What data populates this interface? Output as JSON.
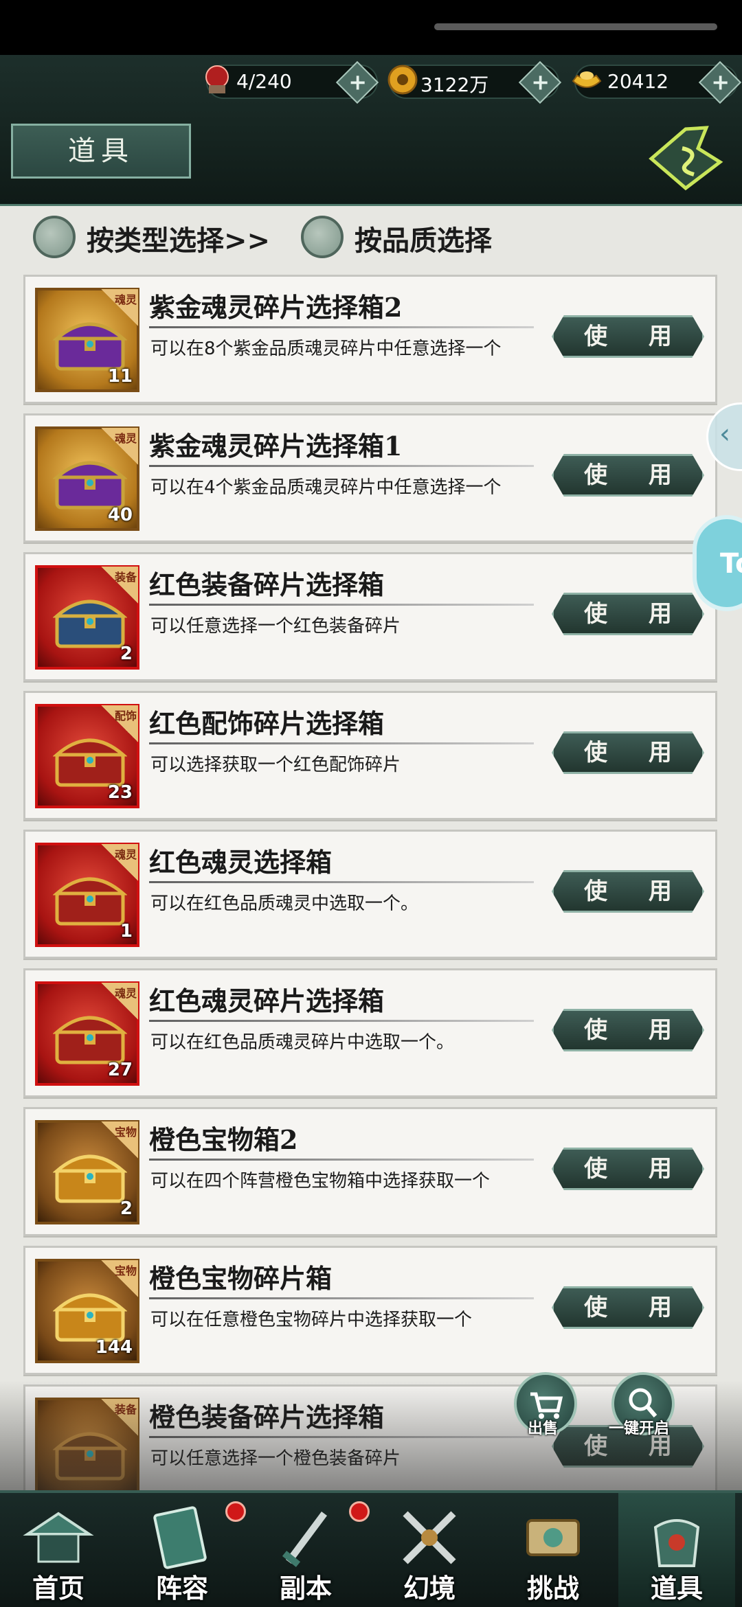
{
  "header": {
    "resources": [
      {
        "name": "stamina",
        "value": "4/240",
        "icon": "ball-icon",
        "color": "#b01f1f"
      },
      {
        "name": "coins",
        "value": "3122万",
        "icon": "coin-icon",
        "color": "#e0a020"
      },
      {
        "name": "ingots",
        "value": "20412",
        "icon": "ingot-icon",
        "color": "#e8b42a"
      }
    ],
    "page_title": "道具"
  },
  "filters": {
    "by_type": "按类型选择>>",
    "by_quality": "按品质选择"
  },
  "items": [
    {
      "name": "紫金魂灵碎片选择箱2",
      "desc": "可以在8个紫金品质魂灵碎片中任意选择一个",
      "count": "11",
      "tag": "魂灵",
      "frame": "gold",
      "chest": "purple"
    },
    {
      "name": "紫金魂灵碎片选择箱1",
      "desc": "可以在4个紫金品质魂灵碎片中任意选择一个",
      "count": "40",
      "tag": "魂灵",
      "frame": "gold",
      "chest": "purple"
    },
    {
      "name": "红色装备碎片选择箱",
      "desc": "可以任意选择一个红色装备碎片",
      "count": "2",
      "tag": "装备",
      "frame": "red",
      "chest": "blue-gold"
    },
    {
      "name": "红色配饰碎片选择箱",
      "desc": "可以选择获取一个红色配饰碎片",
      "count": "23",
      "tag": "配饰",
      "frame": "red",
      "chest": "red-gold"
    },
    {
      "name": "红色魂灵选择箱",
      "desc": "可以在红色品质魂灵中选取一个。",
      "count": "1",
      "tag": "魂灵",
      "frame": "red",
      "chest": "red-gold"
    },
    {
      "name": "红色魂灵碎片选择箱",
      "desc": "可以在红色品质魂灵碎片中选取一个。",
      "count": "27",
      "tag": "魂灵",
      "frame": "red",
      "chest": "red-gold"
    },
    {
      "name": "橙色宝物箱2",
      "desc": "可以在四个阵营橙色宝物箱中选择获取一个",
      "count": "2",
      "tag": "宝物",
      "frame": "bronze",
      "chest": "gold"
    },
    {
      "name": "橙色宝物碎片箱",
      "desc": "可以在任意橙色宝物碎片中选择获取一个",
      "count": "144",
      "tag": "宝物",
      "frame": "bronze",
      "chest": "gold"
    },
    {
      "name": "橙色装备碎片选择箱",
      "desc": "可以任意选择一个橙色装备碎片",
      "count": "",
      "tag": "装备",
      "frame": "bronze",
      "chest": "bronze"
    }
  ],
  "use_label": "使 用",
  "float_buttons": {
    "sell": "出售",
    "one_click_open": "一键开启"
  },
  "side_bubble": "To",
  "bottom_nav": [
    {
      "label": "首页",
      "icon": "pavilion-icon",
      "badge": false,
      "active": false
    },
    {
      "label": "阵容",
      "icon": "book-icon",
      "badge": true,
      "active": false
    },
    {
      "label": "副本",
      "icon": "sword-icon",
      "badge": true,
      "active": false
    },
    {
      "label": "幻境",
      "icon": "crossed-swords-icon",
      "badge": false,
      "active": false
    },
    {
      "label": "挑战",
      "icon": "scroll-icon",
      "badge": false,
      "active": false
    },
    {
      "label": "道具",
      "icon": "bag-icon",
      "badge": false,
      "active": true
    }
  ]
}
